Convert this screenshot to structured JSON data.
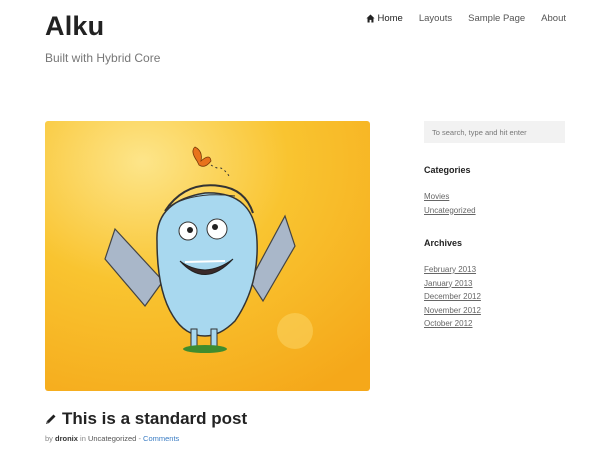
{
  "site": {
    "title": "Alku",
    "description": "Built with Hybrid Core"
  },
  "nav": {
    "items": [
      {
        "label": "Home",
        "current": true
      },
      {
        "label": "Layouts"
      },
      {
        "label": "Sample Page"
      },
      {
        "label": "About"
      }
    ]
  },
  "post": {
    "title": "This is a standard post",
    "byline": {
      "by": "by",
      "author": "dronix",
      "in": "in",
      "category": "Uncategorized",
      "separator": "-",
      "comments": "Comments"
    },
    "image_colors": {
      "background": "#f7b824",
      "monster": "#a8d8ef",
      "butterfly": "#e8731c"
    }
  },
  "sidebar": {
    "search": {
      "placeholder": "To search, type and hit enter"
    },
    "categories": {
      "title": "Categories",
      "items": [
        "Movies",
        "Uncategorized"
      ]
    },
    "archives": {
      "title": "Archives",
      "items": [
        "February 2013",
        "January 2013",
        "December 2012",
        "November 2012",
        "October 2012"
      ]
    }
  },
  "colors": {
    "link": "#3b7dc4",
    "text": "#222222",
    "muted": "#777777"
  }
}
